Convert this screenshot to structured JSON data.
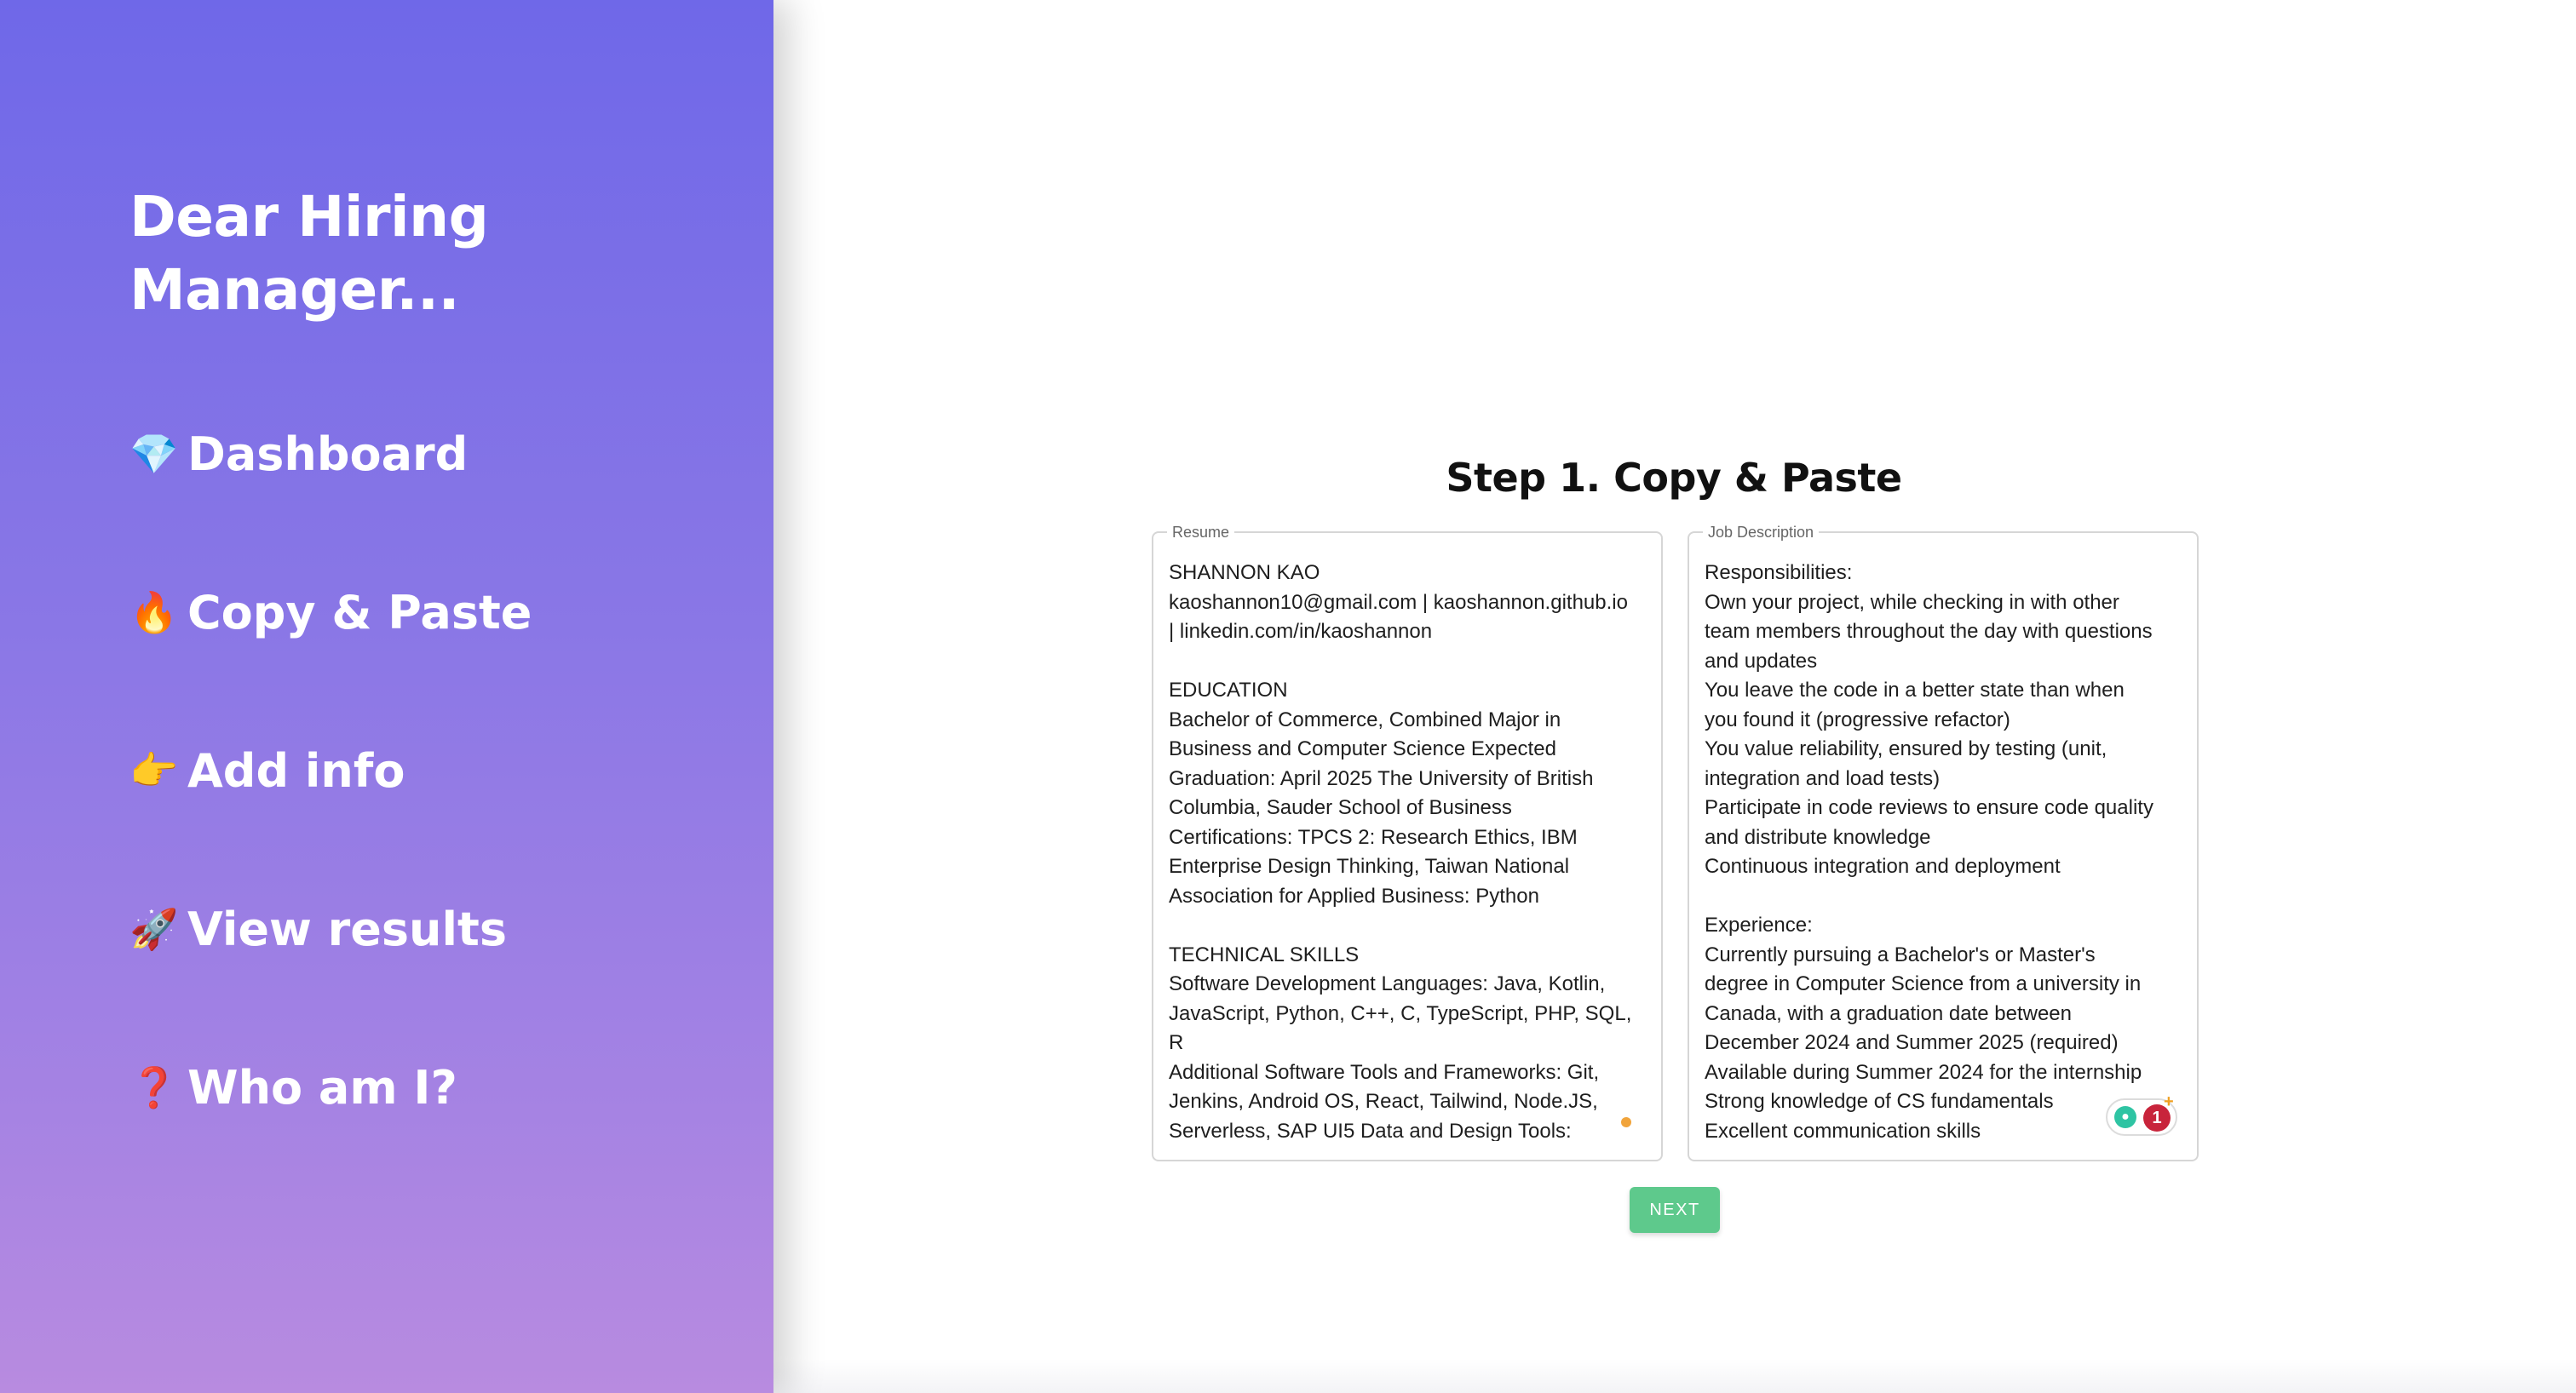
{
  "app": {
    "title_line1": "Dear Hiring",
    "title_line2": "Manager..."
  },
  "sidebar": {
    "items": [
      {
        "icon": "💎",
        "icon_name": "gem-icon",
        "label": "Dashboard"
      },
      {
        "icon": "🔥",
        "icon_name": "fire-icon",
        "label": "Copy & Paste"
      },
      {
        "icon": "👉",
        "icon_name": "pointing-hand-icon",
        "label": "Add info"
      },
      {
        "icon": "🚀",
        "icon_name": "rocket-icon",
        "label": "View results"
      },
      {
        "icon": "❓",
        "icon_name": "question-icon",
        "label": "Who am I?"
      }
    ]
  },
  "main": {
    "step_title": "Step 1. Copy & Paste",
    "resume": {
      "label": "Resume",
      "value": "SHANNON KAO\nkaoshannon10@gmail.com | kaoshannon.github.io\n| linkedin.com/in/kaoshannon\n\nEDUCATION\nBachelor of Commerce, Combined Major in\nBusiness and Computer Science Expected\nGraduation: April 2025 The University of British\nColumbia, Sauder School of Business\nCertifications: TPCS 2: Research Ethics, IBM\nEnterprise Design Thinking, Taiwan National\nAssociation for Applied Business: Python\n\nTECHNICAL SKILLS\nSoftware Development Languages: Java, Kotlin,\nJavaScript, Python, C++, C, TypeScript, PHP, SQL,\nR\nAdditional Software Tools and Frameworks: Git,\nJenkins, Android OS, React, Tailwind, Node.JS,\nServerless, SAP UI5 Data and Design Tools:"
    },
    "job_description": {
      "label": "Job Description",
      "value": "Responsibilities:\nOwn your project, while checking in with other\nteam members throughout the day with questions\nand updates\nYou leave the code in a better state than when\nyou found it (progressive refactor)\nYou value reliability, ensured by testing (unit,\nintegration and load tests)\nParticipate in code reviews to ensure code quality\nand distribute knowledge\nContinuous integration and deployment\n\nExperience:\nCurrently pursuing a Bachelor's or Master's\ndegree in Computer Science from a university in\nCanada, with a graduation date between\nDecember 2024 and Summer 2025 (required)\nAvailable during Summer 2024 for the internship\nStrong knowledge of CS fundamentals\nExcellent communication skills"
    },
    "grammar_widget": {
      "count": "1",
      "plus": "+"
    },
    "next_label": "NEXT"
  },
  "colors": {
    "sidebar_top": "#6f68e8",
    "sidebar_bottom": "#b88be0",
    "next_button": "#5ec98c",
    "badge": "#c8243b"
  }
}
